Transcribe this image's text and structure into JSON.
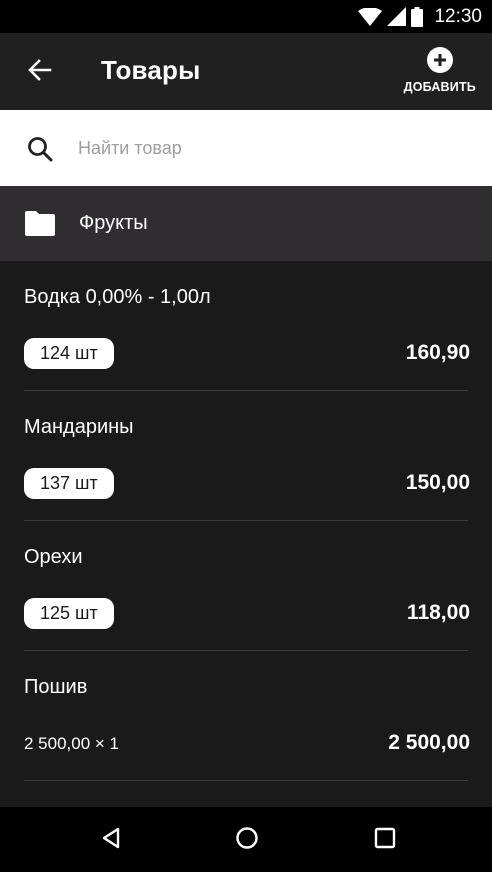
{
  "status_bar": {
    "time": "12:30",
    "icons": [
      "wifi-icon",
      "signal-icon",
      "battery-icon"
    ]
  },
  "app_bar": {
    "back_icon": "arrow-back-icon",
    "title": "Товары",
    "add_icon": "add-circle-icon",
    "add_label": "ДОБАВИТЬ"
  },
  "search": {
    "icon": "search-icon",
    "placeholder": "Найти товар",
    "value": ""
  },
  "category": {
    "icon": "folder-icon",
    "label": "Фрукты"
  },
  "products": [
    {
      "name": "Водка 0,00% - 1,00л",
      "quantity": "124 шт",
      "price": "160,90"
    },
    {
      "name": "Мандарины",
      "quantity": "137 шт",
      "price": "150,00"
    },
    {
      "name": "Орехи",
      "quantity": "125 шт",
      "price": "118,00"
    },
    {
      "name": "Пошив",
      "price_detail": "2 500,00 × 1",
      "price": "2 500,00"
    }
  ],
  "nav_bar": {
    "icons": [
      "nav-back-icon",
      "nav-home-icon",
      "nav-recents-icon"
    ]
  },
  "colors": {
    "background": "#1b1a1b",
    "app_bar": "#212021",
    "category_bg": "#2f2d2f",
    "search_bg": "#ffffff",
    "pill_bg": "#ffffff",
    "text": "#ffffff"
  }
}
